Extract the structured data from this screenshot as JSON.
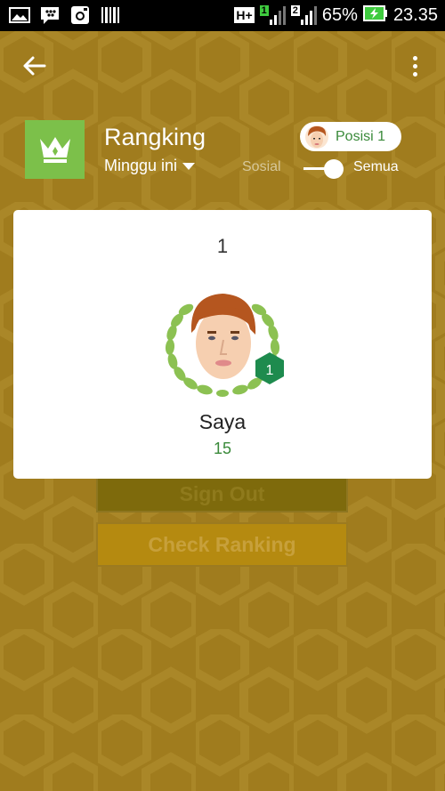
{
  "status_bar": {
    "network": "H+",
    "sim1": "1",
    "sim2": "2",
    "battery_percent": "65%",
    "time": "23.35",
    "icons": [
      "gallery-icon",
      "bbm-icon",
      "instagram-icon",
      "barcode-icon",
      "signal-icon",
      "battery-charging-icon"
    ]
  },
  "header": {
    "title": "Rangking",
    "period": "Minggu ini",
    "position_label": "Posisi 1",
    "toggle_left": "Sosial",
    "toggle_right": "Semua",
    "toggle_state": "Semua"
  },
  "card": {
    "rank": "1",
    "badge_rank": "1",
    "name": "Saya",
    "score": "15"
  },
  "background_buttons": {
    "sign_out": "Sign Out",
    "check_ranking": "Check Ranking"
  },
  "colors": {
    "background": "#a07c1e",
    "accent_green": "#7cc04a",
    "badge_green": "#1e8b4e",
    "score_green": "#3a8a3a"
  }
}
